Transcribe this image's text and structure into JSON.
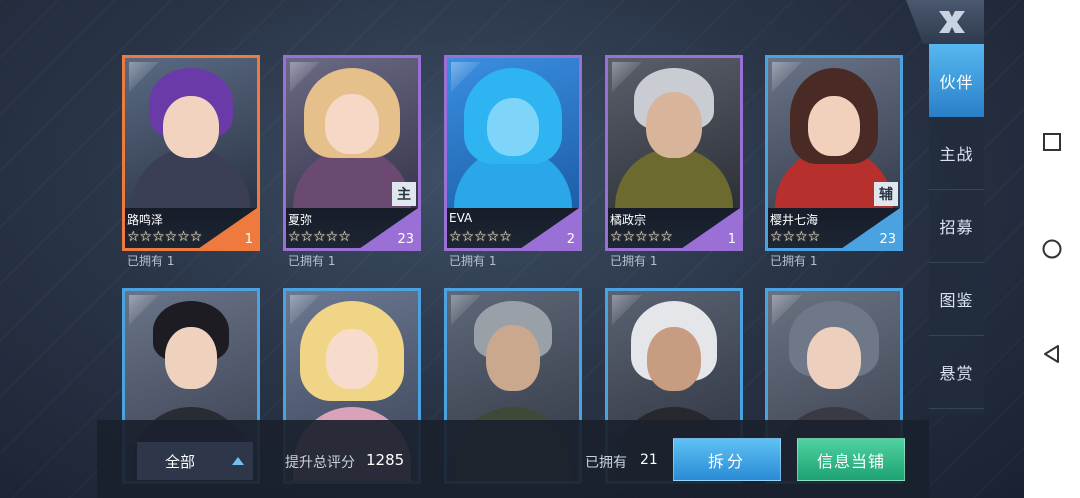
{
  "side_tabs": [
    "伙伴",
    "主战",
    "招募",
    "图鉴",
    "悬赏"
  ],
  "cards_row1": [
    {
      "name": "路鸣泽",
      "stars": "☆☆☆☆☆☆",
      "level": "1",
      "owned": "已拥有 1",
      "frame": "orange",
      "badge": ""
    },
    {
      "name": "夏弥",
      "stars": "☆☆☆☆☆",
      "level": "23",
      "owned": "已拥有 1",
      "frame": "purple",
      "badge": "主"
    },
    {
      "name": "EVA",
      "stars": "☆☆☆☆☆",
      "level": "2",
      "owned": "已拥有 1",
      "frame": "purple",
      "badge": ""
    },
    {
      "name": "橘政宗",
      "stars": "☆☆☆☆☆",
      "level": "1",
      "owned": "已拥有 1",
      "frame": "purple",
      "badge": ""
    },
    {
      "name": "樱井七海",
      "stars": "☆☆☆☆",
      "level": "23",
      "owned": "已拥有 1",
      "frame": "blue",
      "badge": "辅"
    }
  ],
  "bottom": {
    "filter_label": "全部",
    "score_label": "提升总评分",
    "score_value": "1285",
    "owned_label": "已拥有",
    "owned_value": "21",
    "split_button": "拆分",
    "shop_button": "信息当铺"
  },
  "colors": {
    "orange_frame": "#ee7a3e",
    "purple_frame": "#9a6fd6",
    "blue_frame": "#4aa3e0",
    "active_tab": "#3a9ae0",
    "split_button": "#3aa2e4",
    "shop_button": "#2fb985"
  },
  "icons": [
    "close-x-icon",
    "filter-up-arrow-icon",
    "nav-square-icon",
    "nav-circle-icon",
    "nav-back-triangle-icon"
  ]
}
